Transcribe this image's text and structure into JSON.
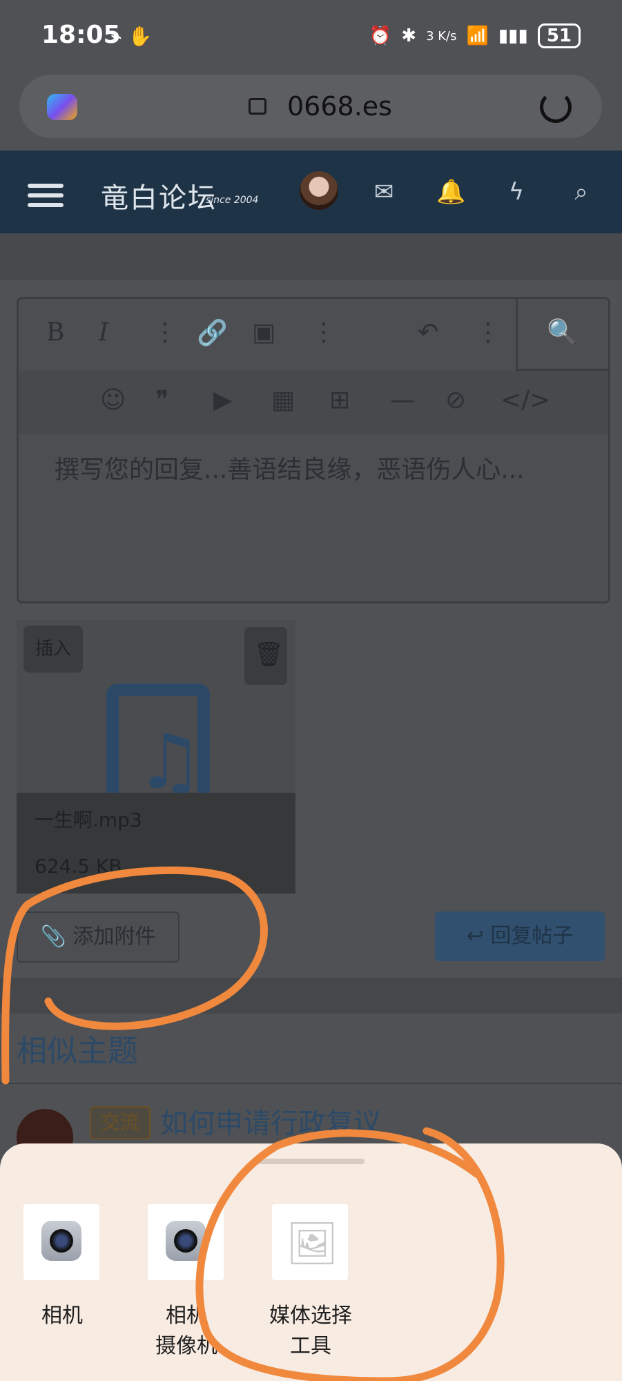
{
  "status_bar": {
    "time": "18:05",
    "battery": "51",
    "net_speed": "3 K/s"
  },
  "browser": {
    "url": "0668.es"
  },
  "site": {
    "brand": "竜白论坛",
    "brand_since": "since 2004"
  },
  "editor": {
    "placeholder": "撰写您的回复...善语结良缘，恶语伤人心..."
  },
  "attachment": {
    "insert_label": "插入",
    "filename": "一生啊.mp3",
    "size": "624.5 KB"
  },
  "actions": {
    "add_attachment": "添加附件",
    "reply": "回复帖子"
  },
  "similar": {
    "heading": "相似主题",
    "items": [
      {
        "tag": "交流",
        "title": "如何申请行政复议"
      }
    ]
  },
  "sheet": {
    "apps": [
      {
        "label_line1": "相机",
        "label_line2": "",
        "icon": "camera-icon"
      },
      {
        "label_line1": "相机",
        "label_line2": "摄像机",
        "icon": "camera-icon"
      },
      {
        "label_line1": "媒体选择",
        "label_line2": "工具",
        "icon": "gallery-icon"
      }
    ]
  },
  "colors": {
    "nav": "#1f3346",
    "sheet": "#f7ebe2",
    "annotation": "#f0883e"
  }
}
